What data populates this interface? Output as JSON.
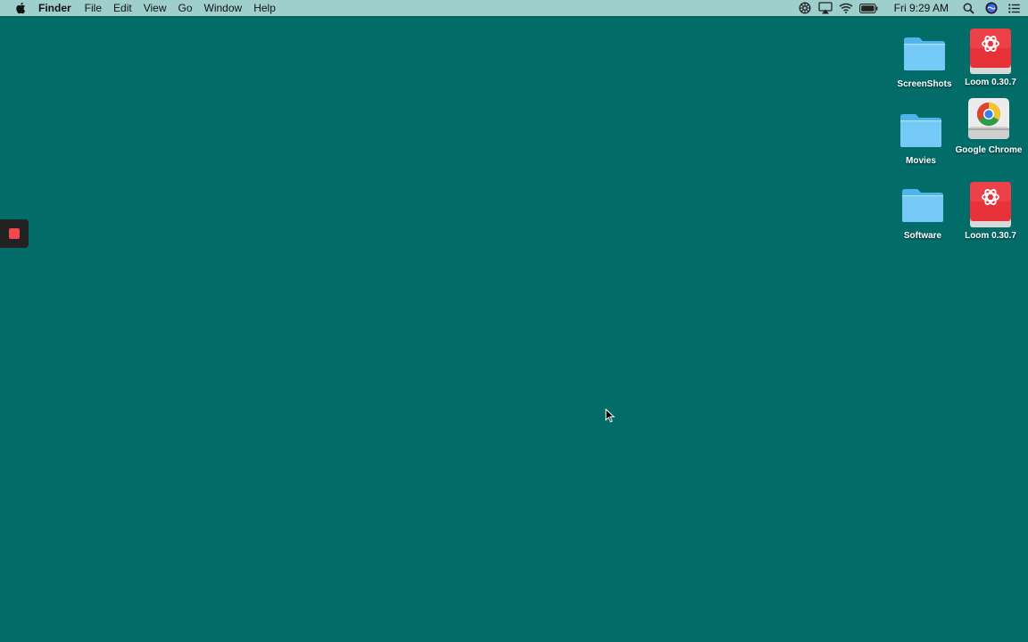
{
  "menubar": {
    "apple_icon": "apple-icon",
    "app_name": "Finder",
    "menus": [
      "File",
      "Edit",
      "View",
      "Go",
      "Window",
      "Help"
    ],
    "status_icons": [
      "loom-icon",
      "airplay-icon",
      "wifi-icon",
      "battery-icon"
    ],
    "clock": "Fri 9:29 AM",
    "right_icons": [
      "search-icon",
      "siri-icon",
      "notification-center-icon"
    ]
  },
  "desktop": {
    "background_color": "#016c68",
    "icons": [
      {
        "label": "ScreenShots",
        "kind": "folder-icon"
      },
      {
        "label": "Loom 0.30.7",
        "kind": "loom-disk-icon"
      },
      {
        "label": "Movies",
        "kind": "folder-icon"
      },
      {
        "label": "Google Chrome",
        "kind": "chrome-disk-icon"
      },
      {
        "label": "Software",
        "kind": "folder-icon"
      },
      {
        "label": "Loom 0.30.7",
        "kind": "loom-disk-icon"
      }
    ]
  },
  "recording_widget": {
    "icon": "stop-recording-icon",
    "color": "#f0484d"
  }
}
